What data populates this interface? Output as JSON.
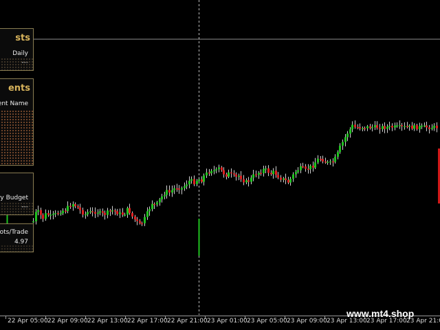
{
  "panels": {
    "forecasts": {
      "title": "sts",
      "period": "Daily",
      "value": "---"
    },
    "instruments": {
      "title": "ents",
      "field": "ent Name"
    },
    "budget": {
      "label": "ry Budget",
      "value": "---"
    },
    "lots": {
      "label": "ots/Trade",
      "value": "4.97"
    }
  },
  "watermark": "www.mt4.shop",
  "x_axis": {
    "labels": [
      "22 Apr 05:00",
      "22 Apr 09:00",
      "22 Apr 13:00",
      "22 Apr 17:00",
      "22 Apr 21:00",
      "23 Apr 01:00",
      "23 Apr 05:00",
      "23 Apr 09:00",
      "23 Apr 13:00",
      "23 Apr 17:00",
      "23 Apr 21:00"
    ]
  },
  "colors": {
    "background": "#000000",
    "bull": "#1fc21f",
    "bear": "#e02020",
    "panel_border": "#8a7d52",
    "title": "#d8b45c"
  },
  "chart_data": {
    "type": "candlestick",
    "price_path": [
      [
        0,
        350
      ],
      [
        5,
        352
      ],
      [
        10,
        345
      ],
      [
        15,
        350
      ],
      [
        20,
        348
      ],
      [
        25,
        343
      ],
      [
        30,
        355
      ],
      [
        35,
        348
      ],
      [
        38,
        352
      ],
      [
        42,
        335
      ],
      [
        48,
        322
      ],
      [
        53,
        305
      ],
      [
        58,
        312
      ],
      [
        62,
        318
      ],
      [
        67,
        310
      ],
      [
        73,
        315
      ],
      [
        80,
        312
      ],
      [
        88,
        307
      ],
      [
        96,
        305
      ],
      [
        100,
        300
      ],
      [
        105,
        296
      ],
      [
        111,
        300
      ],
      [
        118,
        308
      ],
      [
        124,
        312
      ],
      [
        128,
        308
      ],
      [
        134,
        310
      ],
      [
        140,
        307
      ],
      [
        145,
        310
      ],
      [
        151,
        312
      ],
      [
        158,
        308
      ],
      [
        164,
        306
      ],
      [
        170,
        309
      ],
      [
        176,
        312
      ],
      [
        182,
        310
      ],
      [
        186,
        303
      ],
      [
        192,
        315
      ],
      [
        198,
        322
      ],
      [
        204,
        328
      ],
      [
        210,
        318
      ],
      [
        216,
        305
      ],
      [
        221,
        295
      ],
      [
        226,
        300
      ],
      [
        231,
        292
      ],
      [
        236,
        285
      ],
      [
        241,
        278
      ],
      [
        246,
        280
      ],
      [
        252,
        275
      ],
      [
        258,
        272
      ],
      [
        264,
        274
      ],
      [
        270,
        268
      ],
      [
        276,
        262
      ],
      [
        282,
        265
      ],
      [
        288,
        260
      ],
      [
        292,
        263
      ],
      [
        297,
        255
      ],
      [
        303,
        250
      ],
      [
        308,
        246
      ],
      [
        313,
        250
      ],
      [
        318,
        245
      ],
      [
        323,
        250
      ],
      [
        328,
        255
      ],
      [
        333,
        252
      ],
      [
        338,
        256
      ],
      [
        343,
        258
      ],
      [
        348,
        255
      ],
      [
        353,
        262
      ],
      [
        358,
        265
      ],
      [
        363,
        262
      ],
      [
        368,
        256
      ],
      [
        373,
        252
      ],
      [
        378,
        250
      ],
      [
        384,
        246
      ],
      [
        388,
        248
      ],
      [
        393,
        253
      ],
      [
        398,
        250
      ],
      [
        403,
        255
      ],
      [
        409,
        260
      ],
      [
        414,
        262
      ],
      [
        419,
        265
      ],
      [
        424,
        258
      ],
      [
        429,
        250
      ],
      [
        434,
        246
      ],
      [
        439,
        244
      ],
      [
        444,
        248
      ],
      [
        449,
        244
      ],
      [
        454,
        242
      ],
      [
        459,
        235
      ],
      [
        464,
        230
      ],
      [
        469,
        232
      ],
      [
        474,
        236
      ],
      [
        479,
        238
      ],
      [
        484,
        235
      ],
      [
        489,
        228
      ],
      [
        494,
        215
      ],
      [
        499,
        205
      ],
      [
        504,
        195
      ],
      [
        509,
        188
      ],
      [
        513,
        182
      ],
      [
        516,
        185
      ]
    ],
    "highlighted_candle": "22 Apr 21:00"
  }
}
